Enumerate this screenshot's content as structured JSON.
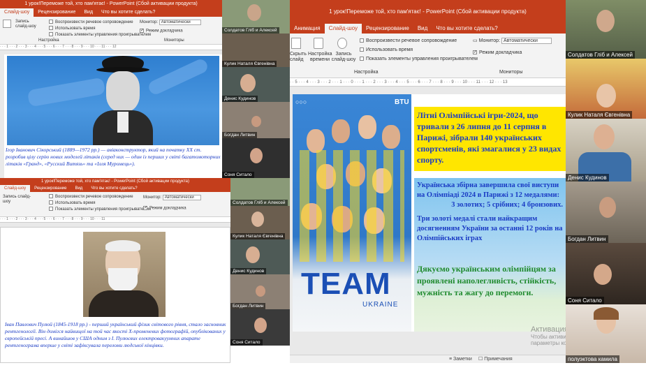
{
  "window_top_left": {
    "title": "1 урок!Переможе той, хто пам'ятає! - PowerPoint (Сбой активации продукта)",
    "tabs": [
      "Слайд-шоу",
      "Рецензирование",
      "Вид",
      "Что вы хотите сделать?"
    ],
    "record_label": "Запись слайд-шоу",
    "checkboxes": [
      "Воспроизвести речевое сопровождение",
      "Использовать время",
      "Показать элементы управления проигрывателем"
    ],
    "monitor_label": "Монитор:",
    "monitor_value": "Автоматически",
    "presenter_label": "Режим докладчика",
    "group_setup": "Настройка",
    "group_monitors": "Мониторы",
    "slide_text": "Ігор Іванович Сікорський (1889—1972 рр.) — авіаконструктор, який на початку XX ст. розробив цілу серію нових моделей літаків (серед них — один із перших у світі багатомоторних літаків «Гранд», «Русский Витязь» та «Ілля Муромець»)."
  },
  "window_bottom_left": {
    "title": "1 урок!Переможе той, хто пам'ятає! - PowerPoint (Сбой активации продукта)",
    "tabs": [
      "Слайд-шоу",
      "Рецензирование",
      "Вид",
      "Что вы хотите сделать?"
    ],
    "record_label": "Запись слайд-шоу",
    "checkboxes": [
      "Воспроизвести речевое сопровождение",
      "Использовать время",
      "Показать элементы управления проигрывателем"
    ],
    "monitor_label": "Монитор:",
    "monitor_value": "Автоматически",
    "presenter_label": "Режим докладчика",
    "slide_text": "Іван Павлович Пулюй (1845-1918 рр.) - перший український фізик світового рівня, стало засновник рентгенології. Він домігся найвищої на той час якості Х-променевих фотографій, опублікованих у європейській пресі. А винайшов у США одним з І. Пулюєвих електровакуумних апарате рентгенограма вперше у світі зафіксувала переломи людської кінцівки."
  },
  "window_main": {
    "title": "1 урок!Переможе той, хто пам'ятає! - PowerPoint (Сбой активации продукта)",
    "tabs": [
      "Анимация",
      "Слайд-шоу",
      "Рецензирование",
      "Вид",
      "Что вы хотите сделать?"
    ],
    "btn_hide": "Скрыть слайд",
    "btn_rehearse": "Настройка времени",
    "btn_record": "Запись слайд-шоу",
    "checkboxes": [
      "Воспроизвести речевое сопровождение",
      "Использовать время",
      "Показать элементы управления проигрывателем"
    ],
    "monitor_label": "Монитор:",
    "monitor_value": "Автоматически",
    "presenter_label": "Режим докладчика",
    "group_setup": "Настройка",
    "group_monitors": "Мониторы",
    "slide": {
      "logo_text": "BTU",
      "team_text": "TEAM",
      "ukraine_text": "UKRAINE",
      "para1": "Літні Олімпійські ігри-2024, що тривали з 26 липня до 11 серпня в Парижі, зібрали 140 українських спортсменів, які змагалися у 23 видах спорту.",
      "para2": "Українська збірна завершила свої виступи на Олімпіаді 2024 в Парижі з 12 медалями:",
      "para2b": "3 золотих; 5 срібних; 4 бронзових.",
      "para3": "Три золоті медалі стали найкращим досягненням України за останні 12 років на Олімпійських іграх",
      "para4": "Дякуємо українським олімпійцям  за проявлені наполегливість, стійкість, мужність та жагу до перемоги."
    },
    "status": {
      "notes": "Заметки",
      "comments": "Примечания"
    },
    "activation_line1": "Активация Windows",
    "activation_line2": "Чтобы активировать Windows, перейдите",
    "activation_line3": "параметры компьютера."
  },
  "participants_small": [
    "Солдатов Гліб и Алексей",
    "Кулик Наталя Євгенівна",
    "Денис Кудинов",
    "Богдан Литвин",
    "Соня Ситало"
  ],
  "participants_small_bottom": [
    "Солдатов Гліб и Алексей",
    "Кулик Наталя Євгенівна",
    "Денис Кудинов",
    "Богдан Литвин",
    "Соня Ситало"
  ],
  "participants_right": [
    "Солдатов Гліб и Алексей",
    "Кулик Наталя Євгенівна",
    "Денис Кудинов",
    "Богдан Литвин",
    "Соня Ситало",
    "полуэктова камила"
  ],
  "colors": {
    "ppt_red": "#c43e1c",
    "slide_blue": "#3d8fd6",
    "text_blue": "#1a3bc4",
    "yellow": "#ffe600"
  }
}
